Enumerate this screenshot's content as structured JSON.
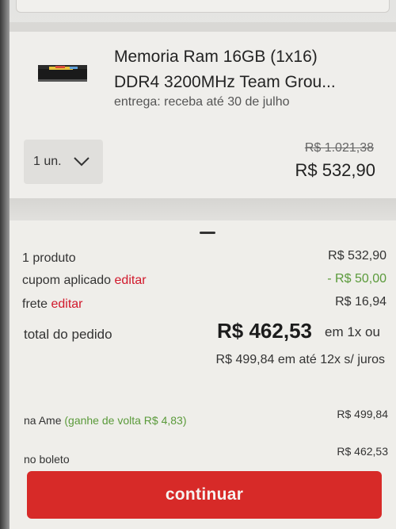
{
  "product": {
    "title_line1": "Memoria Ram 16GB (1x16)",
    "title_line2": "DDR4 3200MHz Team Grou...",
    "delivery": "entrega: receba até 30 de julho",
    "quantity": "1 un.",
    "old_price": "R$ 1.021,38",
    "price": "R$ 532,90"
  },
  "summary": {
    "products_label": "1 produto",
    "products_value": "R$ 532,90",
    "coupon_label": "cupom aplicado",
    "coupon_edit": "editar",
    "coupon_value": "- R$ 50,00",
    "shipping_label": "frete",
    "shipping_edit": "editar",
    "shipping_value": "R$ 16,94",
    "total_label": "total do pedido",
    "total_value": "R$ 462,53",
    "total_suffix": "em 1x ou",
    "installments": "R$ 499,84 em até 12x s/ juros",
    "ame_label": "na Ame",
    "ame_cashback": "(ganhe de volta R$ 4,83)",
    "ame_value": "R$ 499,84",
    "boleto_label": "no boleto",
    "boleto_value": "R$ 462,53"
  },
  "actions": {
    "continue_label": "continuar"
  },
  "colors": {
    "accent_red": "#d72a28",
    "link_red": "#d1182b",
    "discount_green": "#5a9a3a"
  },
  "icons": {
    "quantity_dropdown": "chevron-down-icon",
    "sheet_handle": "drag-handle-icon"
  }
}
